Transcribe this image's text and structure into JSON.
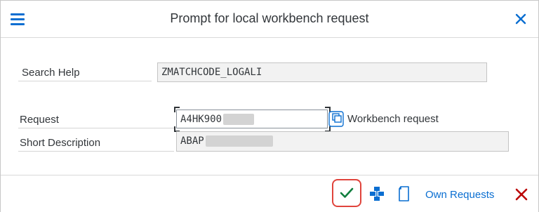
{
  "dialog": {
    "title": "Prompt for local workbench request"
  },
  "fields": {
    "search_help": {
      "label": "Search Help",
      "value": "ZMATCHCODE_LOGALI"
    },
    "request": {
      "label": "Request",
      "value": "A4HK900",
      "description": "Workbench request"
    },
    "short_description": {
      "label": "Short Description",
      "value": "ABAP"
    }
  },
  "footer": {
    "own_requests_label": "Own Requests"
  },
  "colors": {
    "accent": "#0a6ed1",
    "confirm": "#107e3e",
    "cancel": "#bb0000",
    "highlight": "#e0443c"
  },
  "icons": {
    "menu": "hamburger-menu-icon",
    "close": "close-icon",
    "value_help": "value-help-icon",
    "confirm": "checkmark-icon",
    "hierarchy": "hierarchy-icon",
    "new_document": "new-document-icon",
    "cancel": "cancel-x-icon"
  }
}
